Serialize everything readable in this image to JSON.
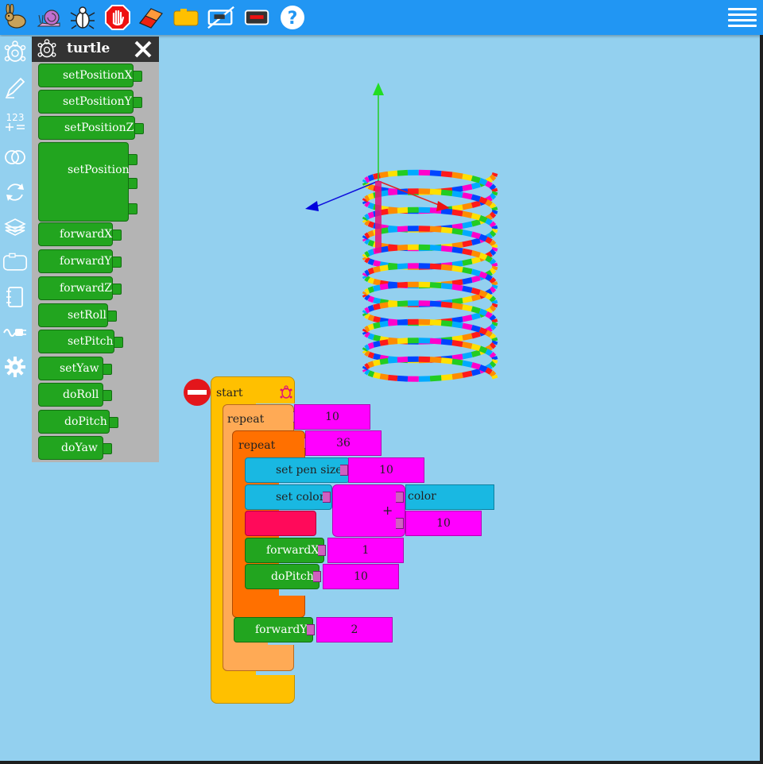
{
  "flyout": {
    "title": "turtle",
    "blocks": [
      {
        "label": "setPositionX"
      },
      {
        "label": "setPositionY"
      },
      {
        "label": "setPositionZ"
      },
      {
        "label": "setPosition"
      },
      {
        "label": "forwardX"
      },
      {
        "label": "forwardY"
      },
      {
        "label": "forwardZ"
      },
      {
        "label": "setRoll"
      },
      {
        "label": "setPitch"
      },
      {
        "label": "setYaw"
      },
      {
        "label": "doRoll"
      },
      {
        "label": "doPitch"
      },
      {
        "label": "doYaw"
      }
    ]
  },
  "palette": {
    "numbers_label": "123"
  },
  "program": {
    "start_label": "start",
    "repeat_outer_label": "repeat",
    "repeat_outer_value": "10",
    "repeat_inner_label": "repeat",
    "repeat_inner_value": "36",
    "pen_size_label": "set pen size",
    "pen_size_value": "10",
    "set_color_label": "set color",
    "plus_label": "+",
    "color_label": "color",
    "plus_value": "10",
    "forwardX_label": "forwardX",
    "forwardX_value": "1",
    "doPitch_label": "doPitch",
    "doPitch_value": "10",
    "forwardY_label": "forwardY",
    "forwardY_value": "2"
  },
  "colors": {
    "toolbar": "#2196f3",
    "canvas": "#93d0ef",
    "turtle_block": "#22a51f",
    "pen_block": "#19b8e2",
    "number_block": "#ff00ff",
    "start_block": "#ffc000",
    "repeat_outer": "#ffaa55",
    "repeat_inner": "#ff7000",
    "hidden_block": "#ff0a5a"
  }
}
